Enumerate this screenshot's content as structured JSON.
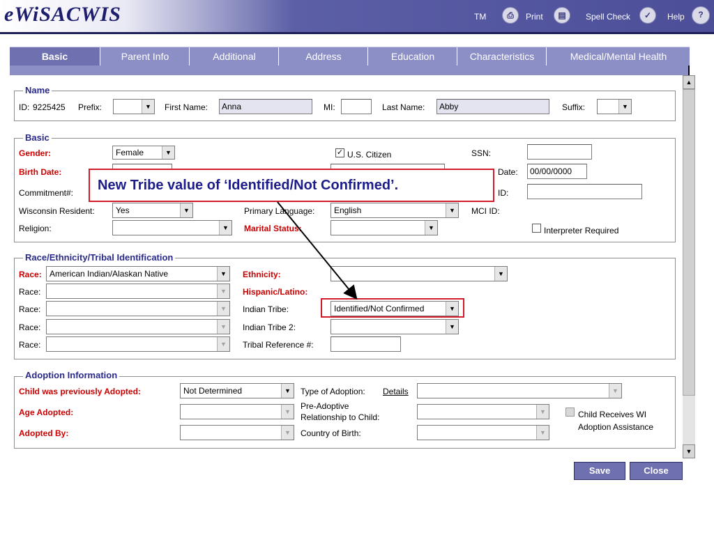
{
  "header": {
    "logo": "eWiSACWIS",
    "links": [
      "TM",
      "Print",
      "Spell Check",
      "Help"
    ]
  },
  "tabs": [
    "Basic",
    "Parent Info",
    "Additional",
    "Address",
    "Education",
    "Characteristics",
    "Medical/Mental Health"
  ],
  "name_section": {
    "legend": "Name",
    "id_label": "ID:",
    "id_value": "9225425",
    "prefix_label": "Prefix:",
    "first_name_label": "First Name:",
    "first_name_value": "Anna",
    "mi_label": "MI:",
    "last_name_label": "Last Name:",
    "last_name_value": "Abby",
    "suffix_label": "Suffix:"
  },
  "basic_section": {
    "legend": "Basic",
    "gender_label": "Gender:",
    "gender_value": "Female",
    "birth_date_label": "Birth Date:",
    "commitment_label": "Commitment#:",
    "wi_resident_label": "Wisconsin Resident:",
    "wi_resident_value": "Yes",
    "religion_label": "Religion:",
    "us_citizen_label": "U.S. Citizen",
    "ssn_label": "SSN:",
    "date_label": "Date:",
    "date_value": "00/00/0000",
    "id2_label": "ID:",
    "primary_language_label": "Primary Language:",
    "primary_language_value": "English",
    "mci_id_label": "MCI ID:",
    "marital_status_label": "Marital Status:",
    "interpreter_label": "Interpreter Required"
  },
  "race_section": {
    "legend": "Race/Ethnicity/Tribal Identification",
    "race_label_primary": "Race:",
    "race_primary_value": "American Indian/Alaskan Native",
    "race_label": "Race:",
    "ethnicity_label": "Ethnicity:",
    "hispanic_label": "Hispanic/Latino:",
    "indian_tribe_label": "Indian Tribe:",
    "indian_tribe_value": "Identified/Not Confirmed",
    "indian_tribe2_label": "Indian Tribe 2:",
    "tribal_ref_label": "Tribal Reference #:"
  },
  "adoption_section": {
    "legend": "Adoption Information",
    "prev_adopted_label": "Child was previously Adopted:",
    "prev_adopted_value": "Not Determined",
    "age_adopted_label": "Age Adopted:",
    "adopted_by_label": "Adopted By:",
    "type_label": "Type of Adoption:",
    "details_link": "Details",
    "pre_adoptive_label_1": "Pre-Adoptive",
    "pre_adoptive_label_2": "Relationship to Child:",
    "country_label": "Country of Birth:",
    "receives_label_1": "Child Receives WI",
    "receives_label_2": "Adoption Assistance"
  },
  "buttons": {
    "save": "Save",
    "close": "Close"
  },
  "callout": "New Tribe value of ‘Identified/Not Confirmed’.",
  "colors": {
    "accent": "#6e70b0",
    "label_red": "#cc0000",
    "callout_border": "#d11a2a",
    "legend": "#2a2a8a"
  }
}
